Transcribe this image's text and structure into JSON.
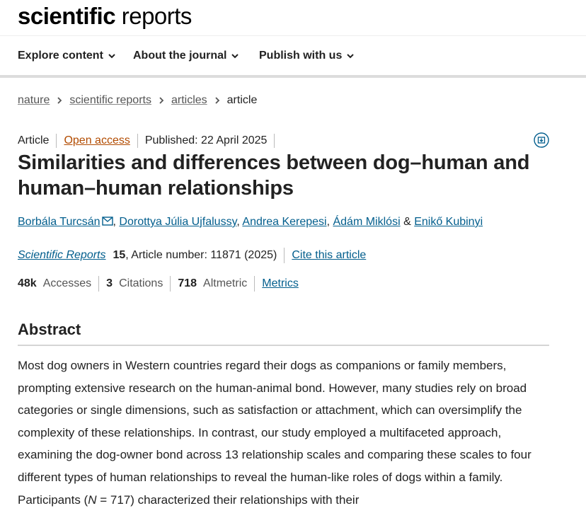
{
  "header": {
    "logo_bold": "scientific",
    "logo_light": " reports"
  },
  "nav": {
    "items": [
      {
        "label": "Explore content"
      },
      {
        "label": "About the journal"
      },
      {
        "label": "Publish with us"
      }
    ]
  },
  "breadcrumb": {
    "items": [
      "nature",
      "scientific reports",
      "articles"
    ],
    "current": "article"
  },
  "article": {
    "type": "Article",
    "access": "Open access",
    "published": "Published: 22 April 2025",
    "title": "Similarities and differences between dog–human and human–human relationships",
    "authors": [
      "Borbála Turcsán",
      "Dorottya Júlia Ujfalussy",
      "Andrea Kerepesi",
      "Ádám Miklósi",
      "Enikő Kubinyi"
    ],
    "author_sep": ", ",
    "author_and": " & ",
    "journal": "Scientific Reports",
    "volume": "15",
    "article_number": ", Article number: 11871 (2025)",
    "cite_label": "Cite this article"
  },
  "metrics": {
    "accesses_value": "48k",
    "accesses_label": "Accesses",
    "citations_value": "3",
    "citations_label": "Citations",
    "altmetric_value": "718",
    "altmetric_label": "Altmetric",
    "metrics_link": "Metrics"
  },
  "abstract": {
    "heading": "Abstract",
    "text_before_n": "Most dog owners in Western countries regard their dogs as companions or family members, prompting extensive research on the human-animal bond. However, many studies rely on broad categories or single dimensions, such as satisfaction or attachment, which can oversimplify the complexity of these relationships. In contrast, our study employed a multifaceted approach, examining the dog-owner bond across 13 relationship scales and comparing these scales to four different types of human relationships to reveal the human-like roles of dogs within a family. Participants (",
    "n_symbol": "N",
    "text_after_n": " = 717) characterized their relationships with their"
  },
  "colors": {
    "link": "#025e8d",
    "open_access": "#b24b00",
    "text": "#222222"
  },
  "icons": {
    "nav_chevron": "chevron-down-icon",
    "breadcrumb_sep": "chevron-right-icon",
    "pdf": "download-pdf-icon",
    "email": "mail-icon"
  }
}
